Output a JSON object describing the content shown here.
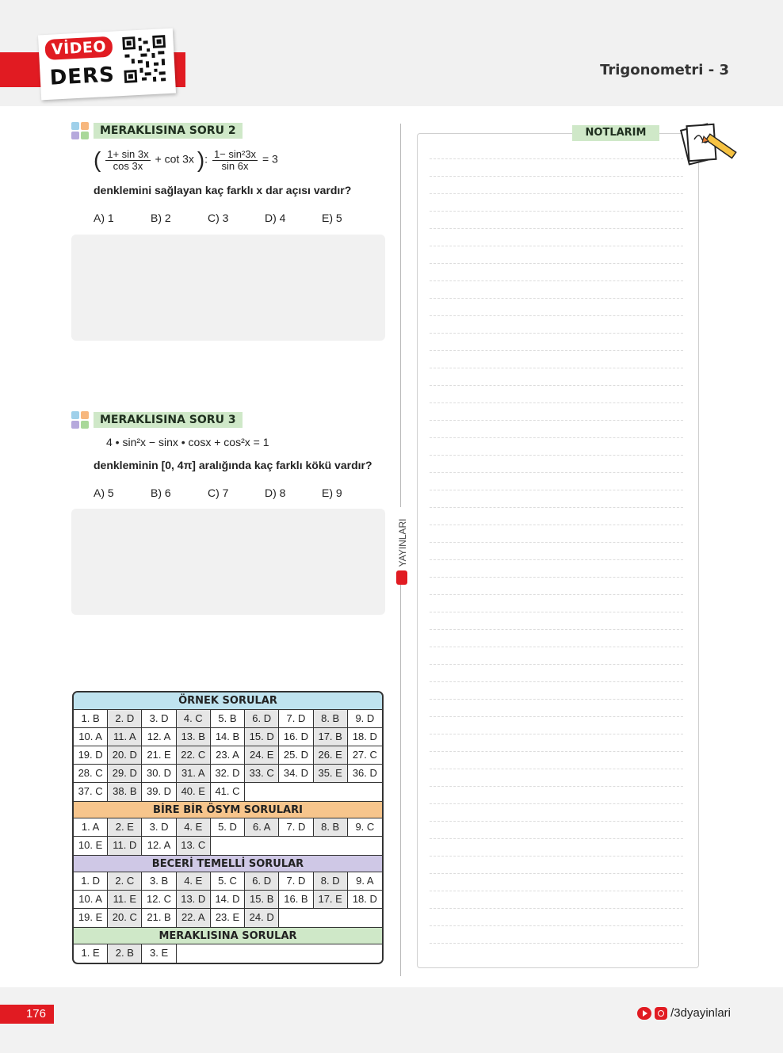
{
  "header": {
    "badge_video": "VİDEO",
    "badge_ders": "DERS",
    "topic": "Trigonometri - 3"
  },
  "question2": {
    "label": "MERAKLISINA SORU 2",
    "eq": {
      "f1_num": "1+ sin 3x",
      "f1_den": "cos 3x",
      "mid": "+ cot 3x",
      "colon": ":",
      "f2_num": "1− sin²3x",
      "f2_den": "sin 6x",
      "rhs": "= 3"
    },
    "text": "denklemini sağlayan kaç farklı x dar açısı vardır?",
    "options": [
      "A) 1",
      "B) 2",
      "C) 3",
      "D) 4",
      "E) 5"
    ]
  },
  "question3": {
    "label": "MERAKLISINA SORU 3",
    "equation": "4 • sin²x − sinx • cosx + cos²x = 1",
    "text": "denkleminin [0, 4π] aralığında kaç farklı kökü vardır?",
    "options": [
      "A) 5",
      "B) 6",
      "C) 7",
      "D) 8",
      "E) 9"
    ]
  },
  "brand_vertical": "YAYINLARI",
  "notes_label": "NOTLARIM",
  "answer_key": {
    "ornek": {
      "title": "ÖRNEK SORULAR",
      "color": "#bfe3ef",
      "rows": [
        [
          "1. B",
          "2. D",
          "3. D",
          "4. C",
          "5. B",
          "6. D",
          "7. D",
          "8. B",
          "9. D"
        ],
        [
          "10. A",
          "11. A",
          "12. A",
          "13. B",
          "14. B",
          "15. D",
          "16. D",
          "17. B",
          "18. D"
        ],
        [
          "19. D",
          "20. D",
          "21. E",
          "22. C",
          "23. A",
          "24. E",
          "25. D",
          "26. E",
          "27. C"
        ],
        [
          "28. C",
          "29. D",
          "30. D",
          "31. A",
          "32. D",
          "33. C",
          "34. D",
          "35. E",
          "36. D"
        ],
        [
          "37. C",
          "38. B",
          "39. D",
          "40. E",
          "41. C"
        ]
      ]
    },
    "osym": {
      "title": "BİRE BİR ÖSYM SORULARI",
      "color": "#f7c58c",
      "rows": [
        [
          "1. A",
          "2. E",
          "3. D",
          "4. E",
          "5. D",
          "6. A",
          "7. D",
          "8. B",
          "9. C"
        ],
        [
          "10. E",
          "11. D",
          "12. A",
          "13. C"
        ]
      ]
    },
    "beceri": {
      "title": "BECERİ TEMELLİ SORULAR",
      "color": "#cfc8e6",
      "rows": [
        [
          "1. D",
          "2. C",
          "3. B",
          "4. E",
          "5. C",
          "6. D",
          "7. D",
          "8. D",
          "9. A"
        ],
        [
          "10. A",
          "11. E",
          "12. C",
          "13. D",
          "14. D",
          "15. B",
          "16. B",
          "17. E",
          "18. D"
        ],
        [
          "19. E",
          "20. C",
          "21. B",
          "22. A",
          "23. E",
          "24. D"
        ]
      ]
    },
    "meraklisina": {
      "title": "MERAKLISINA SORULAR",
      "color": "#cfe8c8",
      "rows": [
        [
          "1. E",
          "2. B",
          "3. E"
        ]
      ]
    }
  },
  "footer": {
    "page_number": "176",
    "social_handle": "/3dyayinlari"
  },
  "colors": {
    "brand_red": "#e11b22",
    "label_green": "#cfe8c8",
    "answer_area": "#f1f1f1"
  }
}
